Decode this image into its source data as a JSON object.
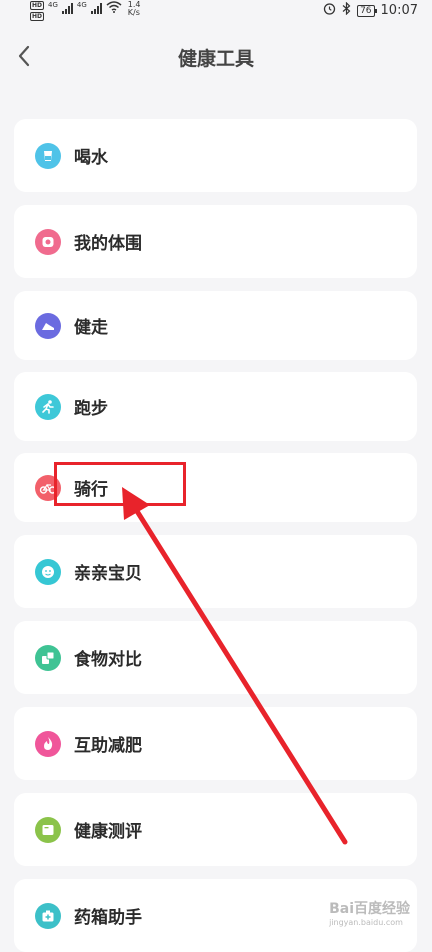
{
  "status_bar": {
    "hd1": "HD",
    "hd2": "HD",
    "net1": "4G",
    "net2": "4G",
    "speed_value": "1.4",
    "speed_unit": "K/s",
    "battery": "76",
    "time": "10:07"
  },
  "header": {
    "title": "健康工具"
  },
  "items": [
    {
      "label": "喝水",
      "icon": "water-cup-icon",
      "color": "#4fc3e8"
    },
    {
      "label": "我的体围",
      "icon": "tape-measure-icon",
      "color": "#f06b8e"
    },
    {
      "label": "健走",
      "icon": "shoe-icon",
      "color": "#6b6be0"
    },
    {
      "label": "跑步",
      "icon": "runner-icon",
      "color": "#3ec8d8"
    },
    {
      "label": "骑行",
      "icon": "bicycle-icon",
      "color": "#f2606a"
    },
    {
      "label": "亲亲宝贝",
      "icon": "baby-face-icon",
      "color": "#36c7d4"
    },
    {
      "label": "食物对比",
      "icon": "food-compare-icon",
      "color": "#3fc394"
    },
    {
      "label": "互助减肥",
      "icon": "flame-icon",
      "color": "#f0569a"
    },
    {
      "label": "健康测评",
      "icon": "report-icon",
      "color": "#8bc34a"
    },
    {
      "label": "药箱助手",
      "icon": "medicine-box-icon",
      "color": "#3cc0c8"
    }
  ],
  "watermark": {
    "brand": "Bai百度经验",
    "url": "jingyan.baidu.com"
  },
  "annotation_color": "#e8232b"
}
